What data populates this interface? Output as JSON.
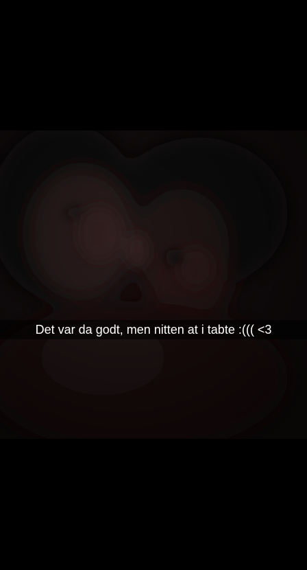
{
  "snap": {
    "caption": "Det var da godt, men nitten at i tabte :((( <3"
  },
  "colors": {
    "background": "#000000",
    "photo_base": "#140d0e",
    "caption_text": "#ffffff"
  }
}
